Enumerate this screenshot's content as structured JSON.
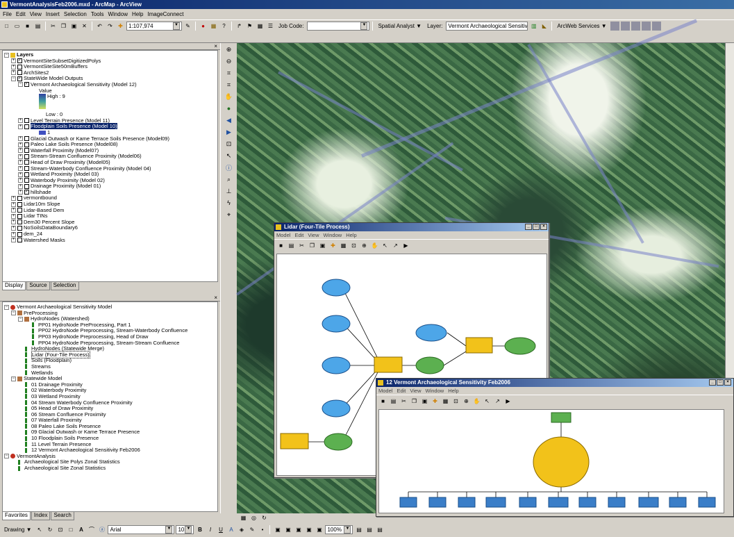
{
  "app": {
    "title": "VermontAnalysisFeb2006.mxd - ArcMap - ArcView"
  },
  "menu": [
    "File",
    "Edit",
    "View",
    "Insert",
    "Selection",
    "Tools",
    "Window",
    "Help",
    "ImageConnect"
  ],
  "toolbar": {
    "scale": "1:107,974",
    "job_code_label": "Job Code:",
    "spatial_analyst": "Spatial Analyst ▼",
    "layer_label": "Layer:",
    "layer_value": "Vermont Archaeological Sensitivit",
    "arcweb": "ArcWeb Services ▼"
  },
  "toc": {
    "root": "Layers",
    "items": [
      {
        "label": "VermontSiteSubsetDigitizedPolys",
        "indent": 1,
        "checked": true
      },
      {
        "label": "VermontSiteSite50mBuffers",
        "indent": 1,
        "checked": false
      },
      {
        "label": "ArchSites2",
        "indent": 1,
        "checked": false
      },
      {
        "label": "StateWide Model Outputs",
        "indent": 1,
        "checked": true,
        "expanded": true
      },
      {
        "label": "Vermont Archaeological Sensitivity (Model 12)",
        "indent": 2,
        "checked": true,
        "expanded": true
      },
      {
        "label": "Level Terrain Presence (Model 11)",
        "indent": 2,
        "checked": false
      },
      {
        "label": "Floodplain Soils Presence (Model 10)",
        "indent": 2,
        "checked": false,
        "selected": true
      },
      {
        "label": "Glacial Outwash or Kame Terrace Soils Presence (Model09)",
        "indent": 2,
        "checked": false
      },
      {
        "label": "Paleo Lake Soils Presence (Model08)",
        "indent": 2,
        "checked": false
      },
      {
        "label": "Waterfall Proximity (Model07)",
        "indent": 2,
        "checked": false
      },
      {
        "label": "Stream-Stream Confluence Proximity (Model06)",
        "indent": 2,
        "checked": false
      },
      {
        "label": "Head of Draw Proximity (Model05)",
        "indent": 2,
        "checked": false
      },
      {
        "label": "Stream-Waterbody Confluence Proximity (Model 04)",
        "indent": 2,
        "checked": false
      },
      {
        "label": "Wetland Proximity (Model 03)",
        "indent": 2,
        "checked": false
      },
      {
        "label": "Waterbody Proximity (Model 02)",
        "indent": 2,
        "checked": false
      },
      {
        "label": "Drainage Proximity (Model 01)",
        "indent": 2,
        "checked": false
      },
      {
        "label": "hillshade",
        "indent": 2,
        "checked": true
      },
      {
        "label": "vermontbound",
        "indent": 1,
        "checked": false
      },
      {
        "label": "Lidar10m Slope",
        "indent": 1,
        "checked": false
      },
      {
        "label": "Lidar-Based Dem",
        "indent": 1,
        "checked": false
      },
      {
        "label": "Lidar TINs",
        "indent": 1,
        "checked": false
      },
      {
        "label": "Dem30 Percent Slope",
        "indent": 1,
        "checked": false
      },
      {
        "label": "NoSoilsDataBoundary6",
        "indent": 1,
        "checked": false
      },
      {
        "label": "dem_24",
        "indent": 1,
        "checked": false
      },
      {
        "label": "Watershed Masks",
        "indent": 1,
        "checked": false
      }
    ],
    "legend_value": "Value",
    "legend_high": "High : 9",
    "legend_low": "Low : 0",
    "floodplain_value": "1",
    "tabs": [
      "Display",
      "Source",
      "Selection"
    ]
  },
  "catalog": {
    "items": [
      {
        "label": "Vermont Archaeological Sensitivity Model",
        "indent": 0,
        "type": "toolbox"
      },
      {
        "label": "PreProcessing",
        "indent": 1,
        "type": "toolset"
      },
      {
        "label": "HydroNodes (Watershed)",
        "indent": 2,
        "type": "toolset"
      },
      {
        "label": "PP01 HydroNode PreProcessing, Part 1",
        "indent": 3,
        "type": "model"
      },
      {
        "label": "PP02 HydroNode Preprocessing, Stream-Waterbody Confluence",
        "indent": 3,
        "type": "model"
      },
      {
        "label": "PP03 HydroNode Preprocessing, Head of Draw",
        "indent": 3,
        "type": "model"
      },
      {
        "label": "PP04 HydroNode Preprocessing, Stream-Stream Confluence",
        "indent": 3,
        "type": "model"
      },
      {
        "label": "HydroNodes (Statewide Merge)",
        "indent": 2,
        "type": "model"
      },
      {
        "label": "Lidar (Four-Tile Process)",
        "indent": 2,
        "type": "model",
        "selected": true
      },
      {
        "label": "Soils (Floodplain)",
        "indent": 2,
        "type": "model"
      },
      {
        "label": "Streams",
        "indent": 2,
        "type": "model"
      },
      {
        "label": "Wetlands",
        "indent": 2,
        "type": "model"
      },
      {
        "label": "Statewide Model",
        "indent": 1,
        "type": "toolset"
      },
      {
        "label": "01 Drainage Proximity",
        "indent": 2,
        "type": "model"
      },
      {
        "label": "02 Waterbody Proximity",
        "indent": 2,
        "type": "model"
      },
      {
        "label": "03 Wetland Proximity",
        "indent": 2,
        "type": "model"
      },
      {
        "label": "04 Stream Waterbody Confluence Proximity",
        "indent": 2,
        "type": "model"
      },
      {
        "label": "05 Head of Draw Proximity",
        "indent": 2,
        "type": "model"
      },
      {
        "label": "06 Stream Confluence Proximity",
        "indent": 2,
        "type": "model"
      },
      {
        "label": "07 Waterfall Proximity",
        "indent": 2,
        "type": "model"
      },
      {
        "label": "08 Paleo Lake Soils Presence",
        "indent": 2,
        "type": "model"
      },
      {
        "label": "09 Glacial Outwash or Kame Terrace Presence",
        "indent": 2,
        "type": "model"
      },
      {
        "label": "10 Floodplain Soils Presence",
        "indent": 2,
        "type": "model"
      },
      {
        "label": "11 Level Terrain Presence",
        "indent": 2,
        "type": "model"
      },
      {
        "label": "12 Vermont Archaeological Sensitivity Feb2006",
        "indent": 2,
        "type": "model"
      },
      {
        "label": "VermontAnalysis",
        "indent": 0,
        "type": "toolbox"
      },
      {
        "label": "Archaeological Site Polys Zonal Statistics",
        "indent": 1,
        "type": "model"
      },
      {
        "label": "Archaeological Site Zonal Statistics",
        "indent": 1,
        "type": "model"
      }
    ],
    "tabs": [
      "Favorites",
      "Index",
      "Search"
    ]
  },
  "lidar_window": {
    "title": "Lidar (Four-Tile Process)",
    "menu": [
      "Model",
      "Edit",
      "View",
      "Window",
      "Help"
    ]
  },
  "sens_window": {
    "title": "12 Vermont Archaeological Sensitivity Feb2006",
    "menu": [
      "Model",
      "Edit",
      "View",
      "Window",
      "Help"
    ]
  },
  "drawbar": {
    "drawing": "Drawing ▼",
    "font": "Arial",
    "size": "10",
    "zoom": "100%"
  }
}
